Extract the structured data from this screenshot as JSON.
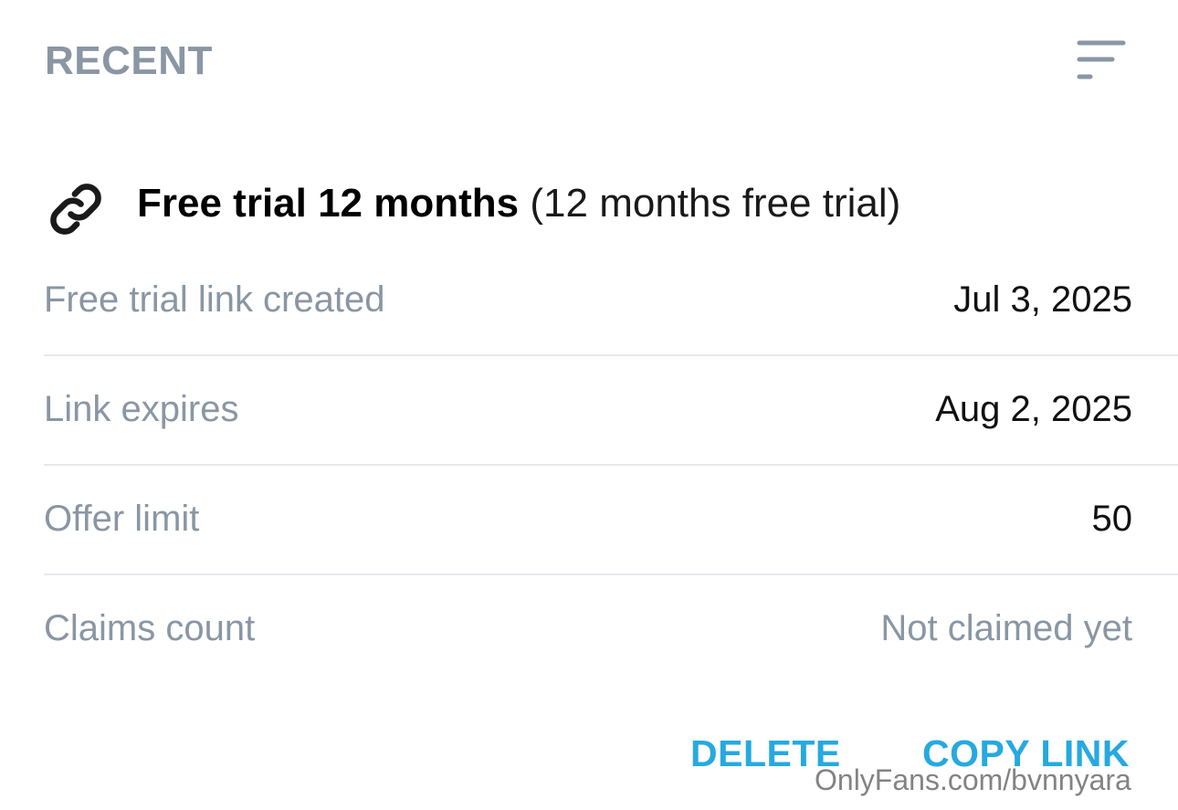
{
  "header": {
    "title": "RECENT",
    "sort_icon": "sort-lines-icon"
  },
  "offer": {
    "icon": "link-icon",
    "name": "Free trial 12 months",
    "description": "(12 months free trial)"
  },
  "details": [
    {
      "label": "Free trial link created",
      "value": "Jul 3, 2025"
    },
    {
      "label": "Link expires",
      "value": "Aug 2, 2025"
    },
    {
      "label": "Offer limit",
      "value": "50"
    },
    {
      "label": "Claims count",
      "value": "Not claimed yet"
    }
  ],
  "actions": {
    "delete_label": "DELETE",
    "copy_label": "COPY LINK"
  },
  "watermark": "OnlyFans.com/bvnnyara",
  "colors": {
    "accent": "#26a9e0",
    "muted": "#8a96a3",
    "divider": "#e6e8ea"
  }
}
